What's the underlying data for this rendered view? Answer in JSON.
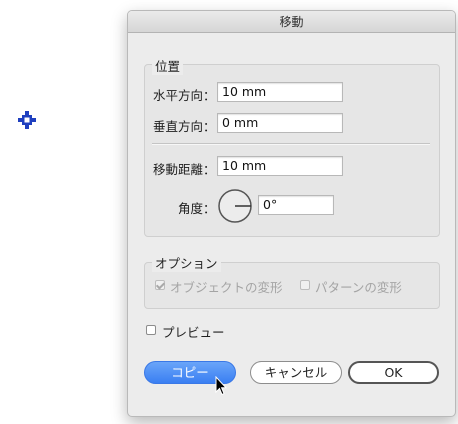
{
  "dialog": {
    "title": "移動"
  },
  "position": {
    "section_label": "位置",
    "horizontal": {
      "label": "水平方向：",
      "value": "10 mm"
    },
    "vertical": {
      "label": "垂直方向：",
      "value": "0 mm"
    },
    "distance": {
      "label": "移動距離：",
      "value": "10 mm"
    },
    "angle": {
      "label": "角度：",
      "value": "0°"
    }
  },
  "options": {
    "section_label": "オプション",
    "transform_objects": {
      "label": "オブジェクトの変形",
      "checked": true,
      "disabled": true
    },
    "transform_patterns": {
      "label": "パターンの変形",
      "checked": false,
      "disabled": true
    }
  },
  "preview": {
    "label": "プレビュー",
    "checked": false
  },
  "buttons": {
    "copy": "コピー",
    "cancel": "キャンセル",
    "ok": "OK"
  },
  "colors": {
    "accent": "#3a7ff2",
    "anchor": "#1f3fbf"
  },
  "icons": [
    "anchor-point-icon",
    "angle-dial-icon",
    "mouse-pointer-icon",
    "checkmark-icon"
  ]
}
